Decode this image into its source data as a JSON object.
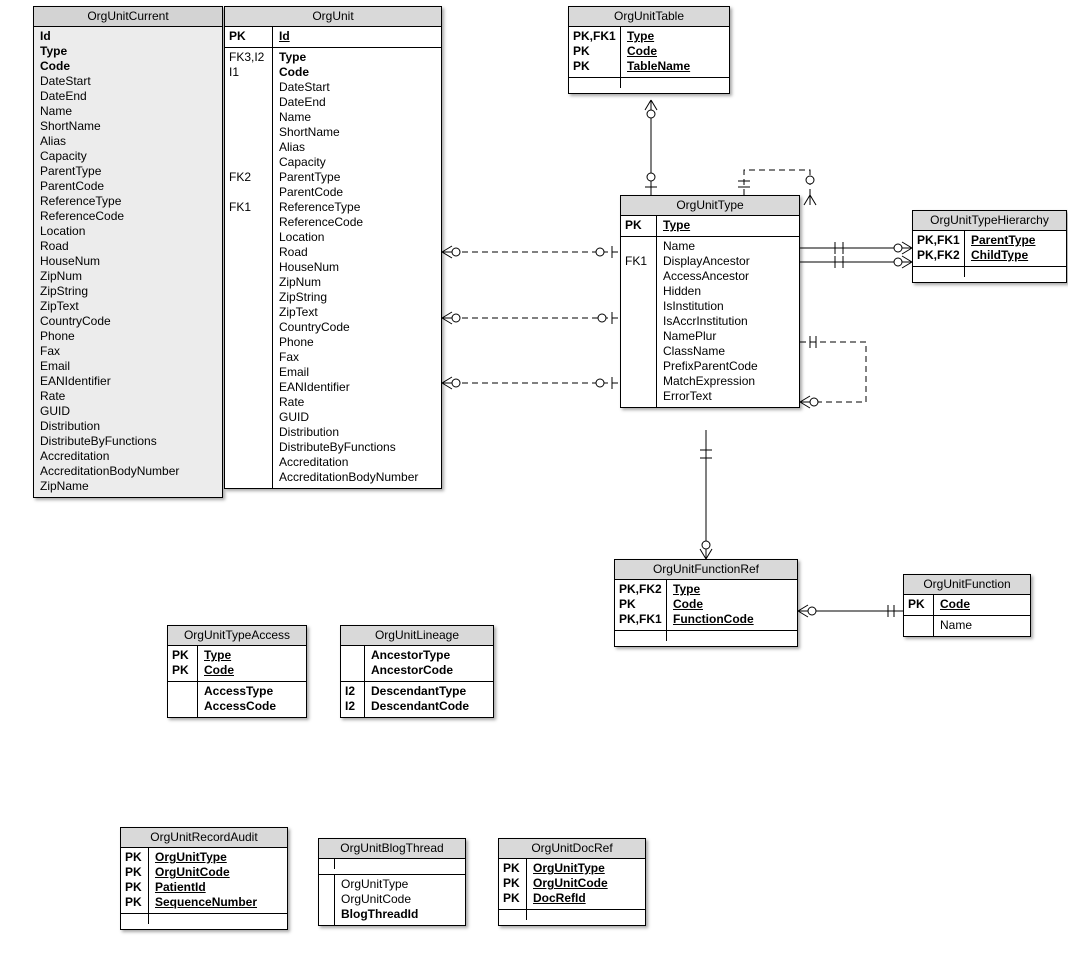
{
  "entities": {
    "OrgUnitCurrent": {
      "title": "OrgUnitCurrent",
      "attrs": [
        "Id",
        "Type",
        "Code",
        "DateStart",
        "DateEnd",
        "Name",
        "ShortName",
        "Alias",
        "Capacity",
        "ParentType",
        "ParentCode",
        "ReferenceType",
        "ReferenceCode",
        "Location",
        "Road",
        "HouseNum",
        "ZipNum",
        "ZipString",
        "ZipText",
        "CountryCode",
        "Phone",
        "Fax",
        "Email",
        "EANIdentifier",
        "Rate",
        "GUID",
        "Distribution",
        "DistributeByFunctions",
        "Accreditation",
        "AccreditationBodyNumber",
        "ZipName"
      ]
    },
    "OrgUnit": {
      "title": "OrgUnit",
      "pk_keys": [
        "PK"
      ],
      "pk_attrs": [
        "Id"
      ],
      "body_keys": [
        "FK3,I2",
        "I1",
        "",
        "",
        "",
        "",
        "",
        "",
        "FK2",
        "",
        "FK1",
        "",
        "",
        "",
        "",
        "",
        "",
        "",
        "",
        "",
        "",
        "",
        "",
        "",
        "",
        "",
        "",
        ""
      ],
      "body_attrs": [
        "Type",
        "Code",
        "DateStart",
        "DateEnd",
        "Name",
        "ShortName",
        "Alias",
        "Capacity",
        "ParentType",
        "ParentCode",
        "ReferenceType",
        "ReferenceCode",
        "Location",
        "Road",
        "HouseNum",
        "ZipNum",
        "ZipString",
        "ZipText",
        "CountryCode",
        "Phone",
        "Fax",
        "Email",
        "EANIdentifier",
        "Rate",
        "GUID",
        "Distribution",
        "DistributeByFunctions",
        "Accreditation",
        "AccreditationBodyNumber"
      ]
    },
    "OrgUnitTable": {
      "title": "OrgUnitTable",
      "pk_keys": [
        "PK,FK1",
        "PK",
        "PK"
      ],
      "pk_attrs": [
        "Type",
        "Code",
        "TableName"
      ]
    },
    "OrgUnitType": {
      "title": "OrgUnitType",
      "pk_keys": [
        "PK"
      ],
      "pk_attrs": [
        "Type"
      ],
      "body_keys": [
        "",
        "FK1",
        "",
        "",
        "",
        "",
        "",
        "",
        "",
        "",
        ""
      ],
      "body_attrs": [
        "Name",
        "DisplayAncestor",
        "AccessAncestor",
        "Hidden",
        "IsInstitution",
        "IsAccrInstitution",
        "NamePlur",
        "ClassName",
        "PrefixParentCode",
        "MatchExpression",
        "ErrorText"
      ]
    },
    "OrgUnitTypeHierarchy": {
      "title": "OrgUnitTypeHierarchy",
      "pk_keys": [
        "PK,FK1",
        "PK,FK2"
      ],
      "pk_attrs": [
        "ParentType",
        "ChildType"
      ]
    },
    "OrgUnitFunctionRef": {
      "title": "OrgUnitFunctionRef",
      "pk_keys": [
        "PK,FK2",
        "PK",
        "PK,FK1"
      ],
      "pk_attrs": [
        "Type",
        "Code",
        "FunctionCode"
      ]
    },
    "OrgUnitFunction": {
      "title": "OrgUnitFunction",
      "pk_keys": [
        "PK"
      ],
      "pk_attrs": [
        "Code"
      ],
      "body_keys": [
        ""
      ],
      "body_attrs": [
        "Name"
      ]
    },
    "OrgUnitTypeAccess": {
      "title": "OrgUnitTypeAccess",
      "pk_keys": [
        "PK",
        "PK"
      ],
      "pk_attrs": [
        "Type",
        "Code"
      ],
      "body_keys": [
        "",
        ""
      ],
      "body_attrs": [
        "AccessType",
        "AccessCode"
      ]
    },
    "OrgUnitLineage": {
      "title": "OrgUnitLineage",
      "top_keys": [
        "",
        ""
      ],
      "top_attrs": [
        "AncestorType",
        "AncestorCode"
      ],
      "body_keys": [
        "I2",
        "I2"
      ],
      "body_attrs": [
        "DescendantType",
        "DescendantCode"
      ]
    },
    "OrgUnitRecordAudit": {
      "title": "OrgUnitRecordAudit",
      "pk_keys": [
        "PK",
        "PK",
        "PK",
        "PK"
      ],
      "pk_attrs": [
        "OrgUnitType",
        "OrgUnitCode",
        "PatientId",
        "SequenceNumber"
      ]
    },
    "OrgUnitBlogThread": {
      "title": "OrgUnitBlogThread",
      "body_keys": [
        "",
        "",
        ""
      ],
      "body_attrs": [
        "OrgUnitType",
        "OrgUnitCode",
        "BlogThreadId"
      ]
    },
    "OrgUnitDocRef": {
      "title": "OrgUnitDocRef",
      "pk_keys": [
        "PK",
        "PK",
        "PK"
      ],
      "pk_attrs": [
        "OrgUnitType",
        "OrgUnitCode",
        "DocRefId"
      ]
    }
  }
}
